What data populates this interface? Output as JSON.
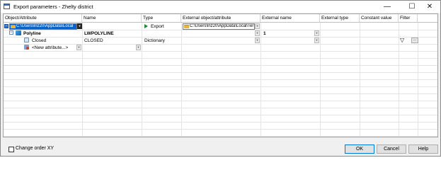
{
  "window": {
    "title": "Export parameters - Zhelty district",
    "controls": {
      "minimize": "—",
      "maximize": "☐",
      "close": "✕"
    }
  },
  "grid": {
    "columns": [
      "Object/Attribute",
      "Name",
      "Type",
      "External object/attribute",
      "External name",
      "External type",
      "Constant value",
      "Filter"
    ],
    "rows": [
      {
        "object": "C:\\Users\\lnz20\\AppData\\Local",
        "type": "Export",
        "external_object": "C:\\Users\\lnz20\\AppData\\Local\\Ter"
      },
      {
        "object": "Polyline",
        "name": "LWPOLYLINE",
        "external_name": "1"
      },
      {
        "object": "Closed",
        "name": "CLOSED",
        "type": "Dictionary",
        "filter_glyph": "▽",
        "filter_button": "..."
      },
      {
        "object": "<New attribute...>"
      }
    ]
  },
  "footer": {
    "checkbox_label": "Change order XY",
    "checkbox_checked": false,
    "ok": "OK",
    "cancel": "Cancel",
    "help": "Help"
  }
}
